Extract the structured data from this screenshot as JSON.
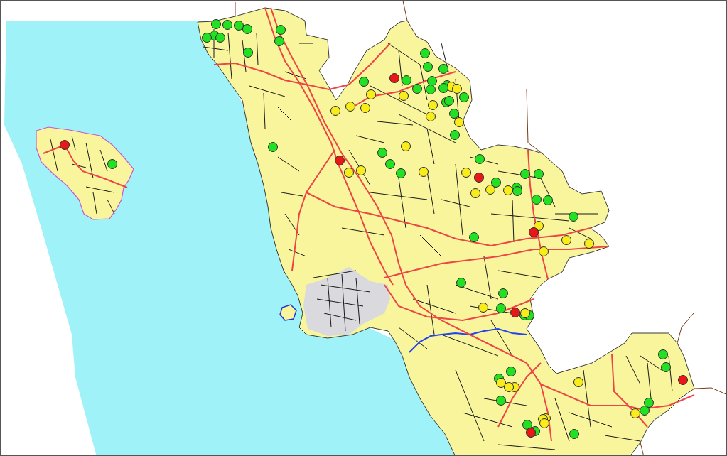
{
  "map": {
    "markers": [
      {
        "color": "#22e022"
      },
      {
        "color": "#22e022"
      },
      {
        "color": "#22e022"
      },
      {
        "color": "#22e022"
      },
      {
        "color": "#22e022"
      },
      {
        "color": "#22e022"
      },
      {
        "color": "#22e022"
      },
      {
        "color": "#22e022"
      },
      {
        "color": "#22e022"
      },
      {
        "color": "#22e022"
      },
      {
        "color": "#22e022"
      },
      {
        "color": "#22e022"
      },
      {
        "color": "#22e022"
      },
      {
        "color": "#e81818"
      },
      {
        "color": "#22e022"
      },
      {
        "color": "#22e022"
      },
      {
        "color": "#22e022"
      },
      {
        "color": "#22e022"
      },
      {
        "color": "#f8ec1c"
      },
      {
        "color": "#22e022"
      },
      {
        "color": "#f8ec1c"
      },
      {
        "color": "#22e022"
      },
      {
        "color": "#22e022"
      },
      {
        "color": "#f8ec1c"
      },
      {
        "color": "#f8ec1c"
      },
      {
        "color": "#22e022"
      },
      {
        "color": "#22e022"
      },
      {
        "color": "#22e022"
      },
      {
        "color": "#f8ec1c"
      },
      {
        "color": "#f8ec1c"
      },
      {
        "color": "#f8ec1c"
      },
      {
        "color": "#f8ec1c"
      },
      {
        "color": "#22e022"
      },
      {
        "color": "#f8ec1c"
      },
      {
        "color": "#f8ec1c"
      },
      {
        "color": "#22e022"
      },
      {
        "color": "#e81818"
      },
      {
        "color": "#f8ec1c"
      },
      {
        "color": "#22e022"
      },
      {
        "color": "#22e022"
      },
      {
        "color": "#22e022"
      },
      {
        "color": "#e81818"
      },
      {
        "color": "#22e022"
      },
      {
        "color": "#22e022"
      },
      {
        "color": "#f8ec1c"
      },
      {
        "color": "#f8ec1c"
      },
      {
        "color": "#f8ec1c"
      },
      {
        "color": "#f8ec1c"
      },
      {
        "color": "#22e022"
      },
      {
        "color": "#22e022"
      },
      {
        "color": "#22e022"
      },
      {
        "color": "#e81818"
      },
      {
        "color": "#22e022"
      },
      {
        "color": "#22e022"
      },
      {
        "color": "#f8ec1c"
      },
      {
        "color": "#f8ec1c"
      },
      {
        "color": "#22e022"
      },
      {
        "color": "#f8ec1c"
      },
      {
        "color": "#22e022"
      },
      {
        "color": "#22e022"
      },
      {
        "color": "#22e022"
      },
      {
        "color": "#f8ec1c"
      },
      {
        "color": "#e81818"
      },
      {
        "color": "#22e022"
      },
      {
        "color": "#f8ec1c"
      },
      {
        "color": "#f8ec1c"
      },
      {
        "color": "#f8ec1c"
      },
      {
        "color": "#22e022"
      },
      {
        "color": "#22e022"
      },
      {
        "color": "#f8ec1c"
      },
      {
        "color": "#22e022"
      },
      {
        "color": "#e81818"
      },
      {
        "color": "#22e022"
      },
      {
        "color": "#22e022"
      },
      {
        "color": "#f8ec1c"
      },
      {
        "color": "#22e022"
      },
      {
        "color": "#22e022"
      },
      {
        "color": "#22e022"
      },
      {
        "color": "#22e022"
      },
      {
        "color": "#e81818"
      },
      {
        "color": "#f8ec1c"
      },
      {
        "color": "#f8ec1c"
      },
      {
        "color": "#f8ec1c"
      },
      {
        "color": "#f8ec1c"
      },
      {
        "color": "#22e022"
      },
      {
        "color": "#22e022"
      },
      {
        "color": "#22e022"
      },
      {
        "color": "#f8ec1c"
      },
      {
        "color": "#f8ec1c"
      },
      {
        "color": "#f8ec1c"
      },
      {
        "color": "#f8ec1c"
      },
      {
        "color": "#22e022"
      },
      {
        "color": "#22e022"
      },
      {
        "color": "#e81818"
      },
      {
        "color": "#22e022"
      }
    ]
  }
}
